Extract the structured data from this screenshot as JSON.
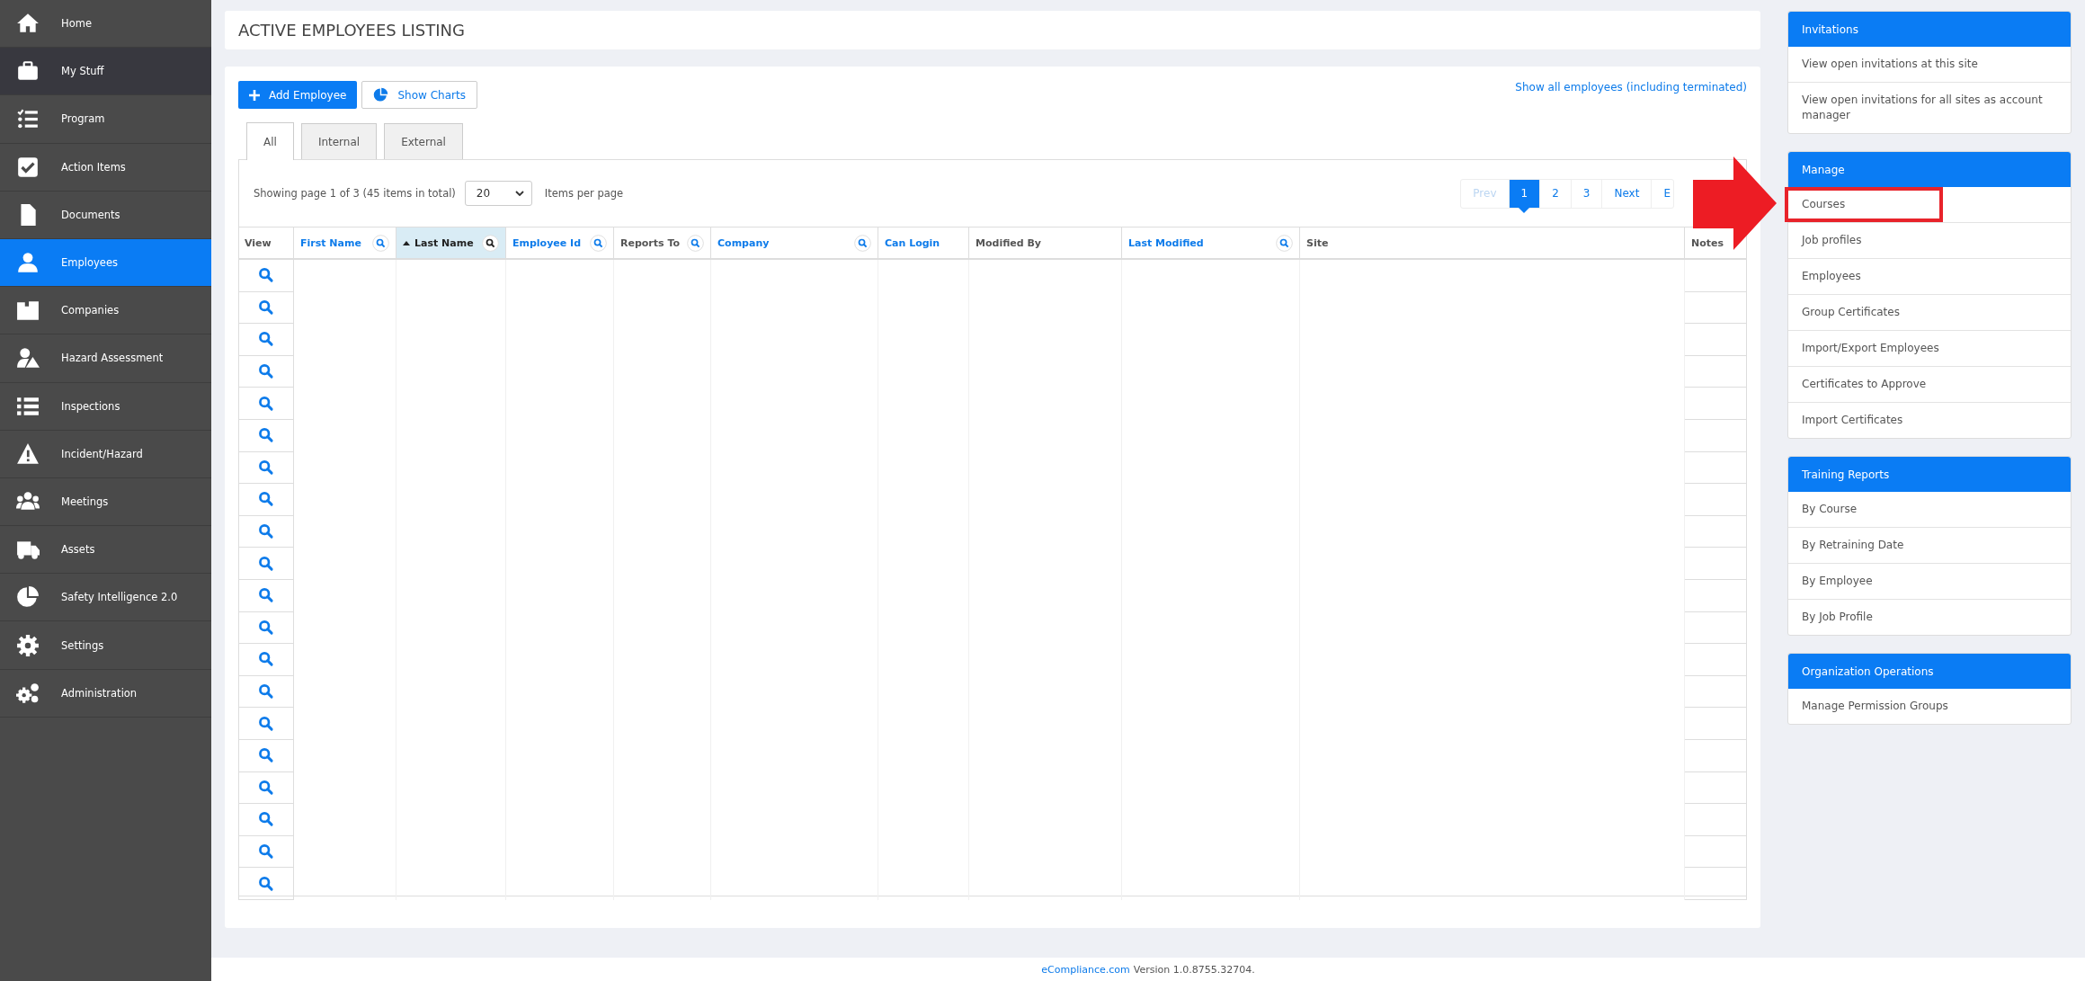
{
  "sidebar": {
    "items": [
      {
        "label": "Home",
        "selected": false,
        "hovered": false
      },
      {
        "label": "My Stuff",
        "selected": false,
        "hovered": true
      },
      {
        "label": "Program",
        "selected": false,
        "hovered": false
      },
      {
        "label": "Action Items",
        "selected": false,
        "hovered": false
      },
      {
        "label": "Documents",
        "selected": false,
        "hovered": false
      },
      {
        "label": "Employees",
        "selected": true,
        "hovered": false
      },
      {
        "label": "Companies",
        "selected": false,
        "hovered": false
      },
      {
        "label": "Hazard Assessment",
        "selected": false,
        "hovered": false
      },
      {
        "label": "Inspections",
        "selected": false,
        "hovered": false
      },
      {
        "label": "Incident/Hazard",
        "selected": false,
        "hovered": false
      },
      {
        "label": "Meetings",
        "selected": false,
        "hovered": false
      },
      {
        "label": "Assets",
        "selected": false,
        "hovered": false
      },
      {
        "label": "Safety Intelligence 2.0",
        "selected": false,
        "hovered": false
      },
      {
        "label": "Settings",
        "selected": false,
        "hovered": false
      },
      {
        "label": "Administration",
        "selected": false,
        "hovered": false
      }
    ]
  },
  "page_title": "ACTIVE EMPLOYEES LISTING",
  "toolbar": {
    "add_button": "Add Employee",
    "charts_button": "Show Charts",
    "show_all_link": "Show all employees (including terminated)"
  },
  "tabs": [
    {
      "label": "All",
      "selected": true
    },
    {
      "label": "Internal",
      "selected": false
    },
    {
      "label": "External",
      "selected": false
    }
  ],
  "paging": {
    "summary": "Showing page 1 of 3 (45 items in total)",
    "page_size": "20",
    "page_size_label": "Items per page",
    "pages": [
      {
        "label": "Prev",
        "selected": false,
        "disabled": true
      },
      {
        "label": "1",
        "selected": true,
        "disabled": false
      },
      {
        "label": "2",
        "selected": false,
        "disabled": false
      },
      {
        "label": "3",
        "selected": false,
        "disabled": false
      },
      {
        "label": "Next",
        "selected": false,
        "disabled": false
      },
      {
        "label": "E",
        "selected": false,
        "disabled": false
      }
    ]
  },
  "table": {
    "columns": [
      {
        "label": "View",
        "sortable": false,
        "filterable": false,
        "selected": false
      },
      {
        "label": "First Name",
        "sortable": true,
        "filterable": true,
        "selected": false
      },
      {
        "label": "Last Name",
        "sortable": true,
        "filterable": true,
        "selected": true
      },
      {
        "label": "Employee Id",
        "sortable": true,
        "filterable": true,
        "selected": false
      },
      {
        "label": "Reports To",
        "sortable": false,
        "filterable": true,
        "selected": false
      },
      {
        "label": "Company",
        "sortable": true,
        "filterable": true,
        "selected": false
      },
      {
        "label": "Can Login",
        "sortable": true,
        "filterable": false,
        "selected": false
      },
      {
        "label": "Modified By",
        "sortable": false,
        "filterable": false,
        "selected": false
      },
      {
        "label": "Last Modified",
        "sortable": true,
        "filterable": true,
        "selected": false
      },
      {
        "label": "Site",
        "sortable": false,
        "filterable": false,
        "selected": false
      },
      {
        "label": "Notes",
        "sortable": false,
        "filterable": false,
        "selected": false
      }
    ],
    "rows": [
      {
        "kind": "row"
      },
      {
        "kind": "row"
      },
      {
        "kind": "row"
      },
      {
        "kind": "row"
      },
      {
        "kind": "row"
      },
      {
        "kind": "row"
      },
      {
        "kind": "row"
      },
      {
        "kind": "row"
      },
      {
        "kind": "row"
      },
      {
        "kind": "row"
      },
      {
        "kind": "row"
      },
      {
        "kind": "row"
      },
      {
        "kind": "row"
      },
      {
        "kind": "row"
      },
      {
        "kind": "row"
      },
      {
        "kind": "row"
      },
      {
        "kind": "row"
      },
      {
        "kind": "row"
      },
      {
        "kind": "row"
      },
      {
        "kind": "row"
      }
    ]
  },
  "panels": [
    {
      "title": "Invitations",
      "items": [
        {
          "label": "View open invitations at this site",
          "highlighted": false
        },
        {
          "label": "View open invitations for all sites as account manager",
          "highlighted": false
        }
      ]
    },
    {
      "title": "Manage",
      "items": [
        {
          "label": "Courses",
          "highlighted": true
        },
        {
          "label": "Job profiles",
          "highlighted": false
        },
        {
          "label": "Employees",
          "highlighted": false
        },
        {
          "label": "Group Certificates",
          "highlighted": false
        },
        {
          "label": "Import/Export Employees",
          "highlighted": false
        },
        {
          "label": "Certificates to Approve",
          "highlighted": false
        },
        {
          "label": "Import Certificates",
          "highlighted": false
        }
      ]
    },
    {
      "title": "Training Reports",
      "items": [
        {
          "label": "By Course",
          "highlighted": false
        },
        {
          "label": "By Retraining Date",
          "highlighted": false
        },
        {
          "label": "By Employee",
          "highlighted": false
        },
        {
          "label": "By Job Profile",
          "highlighted": false
        }
      ]
    },
    {
      "title": "Organization Operations",
      "items": [
        {
          "label": "Manage Permission Groups",
          "highlighted": false
        }
      ]
    }
  ],
  "footer": {
    "link": "eCompliance.com",
    "text": "Version 1.0.8755.32704."
  }
}
